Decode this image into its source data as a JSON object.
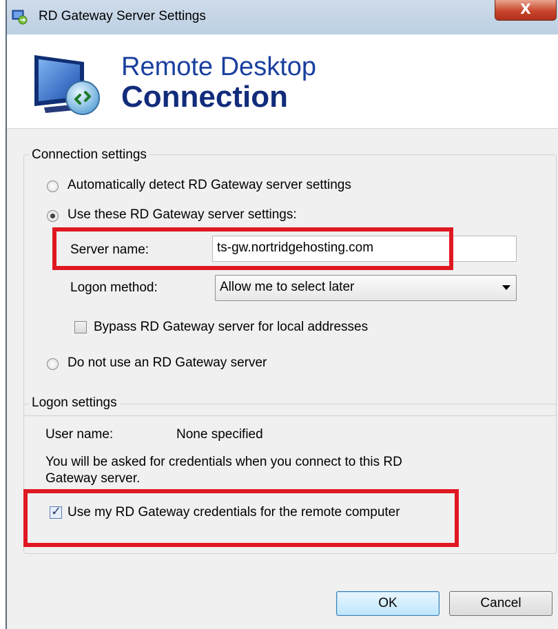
{
  "window": {
    "title": "RD Gateway Server Settings",
    "close_glyph": "X"
  },
  "header": {
    "line1": "Remote Desktop",
    "line2": "Connection"
  },
  "connection_settings": {
    "legend": "Connection settings",
    "auto_detect": {
      "label": "Automatically detect RD Gateway server settings",
      "checked": false
    },
    "use_these": {
      "label": "Use these RD Gateway server settings:",
      "checked": true
    },
    "server_name_label": "Server name:",
    "server_name_value": "ts-gw.nortridgehosting.com",
    "logon_method_label": "Logon method:",
    "logon_method_value": "Allow me to select later",
    "bypass": {
      "label": "Bypass RD Gateway server for local addresses",
      "checked": false
    },
    "do_not_use": {
      "label": "Do not use an RD Gateway server",
      "checked": false
    }
  },
  "logon_settings": {
    "legend": "Logon settings",
    "user_name_label": "User name:",
    "user_name_value": "None specified",
    "info_line1": "You will be asked for credentials when you connect to this RD",
    "info_line2": "Gateway server.",
    "use_credentials": {
      "label": "Use my RD Gateway credentials for the remote computer",
      "checked": true
    }
  },
  "buttons": {
    "ok": "OK",
    "cancel": "Cancel"
  },
  "colors": {
    "highlight": "#e01822",
    "header_title": "#1a3f9e"
  }
}
